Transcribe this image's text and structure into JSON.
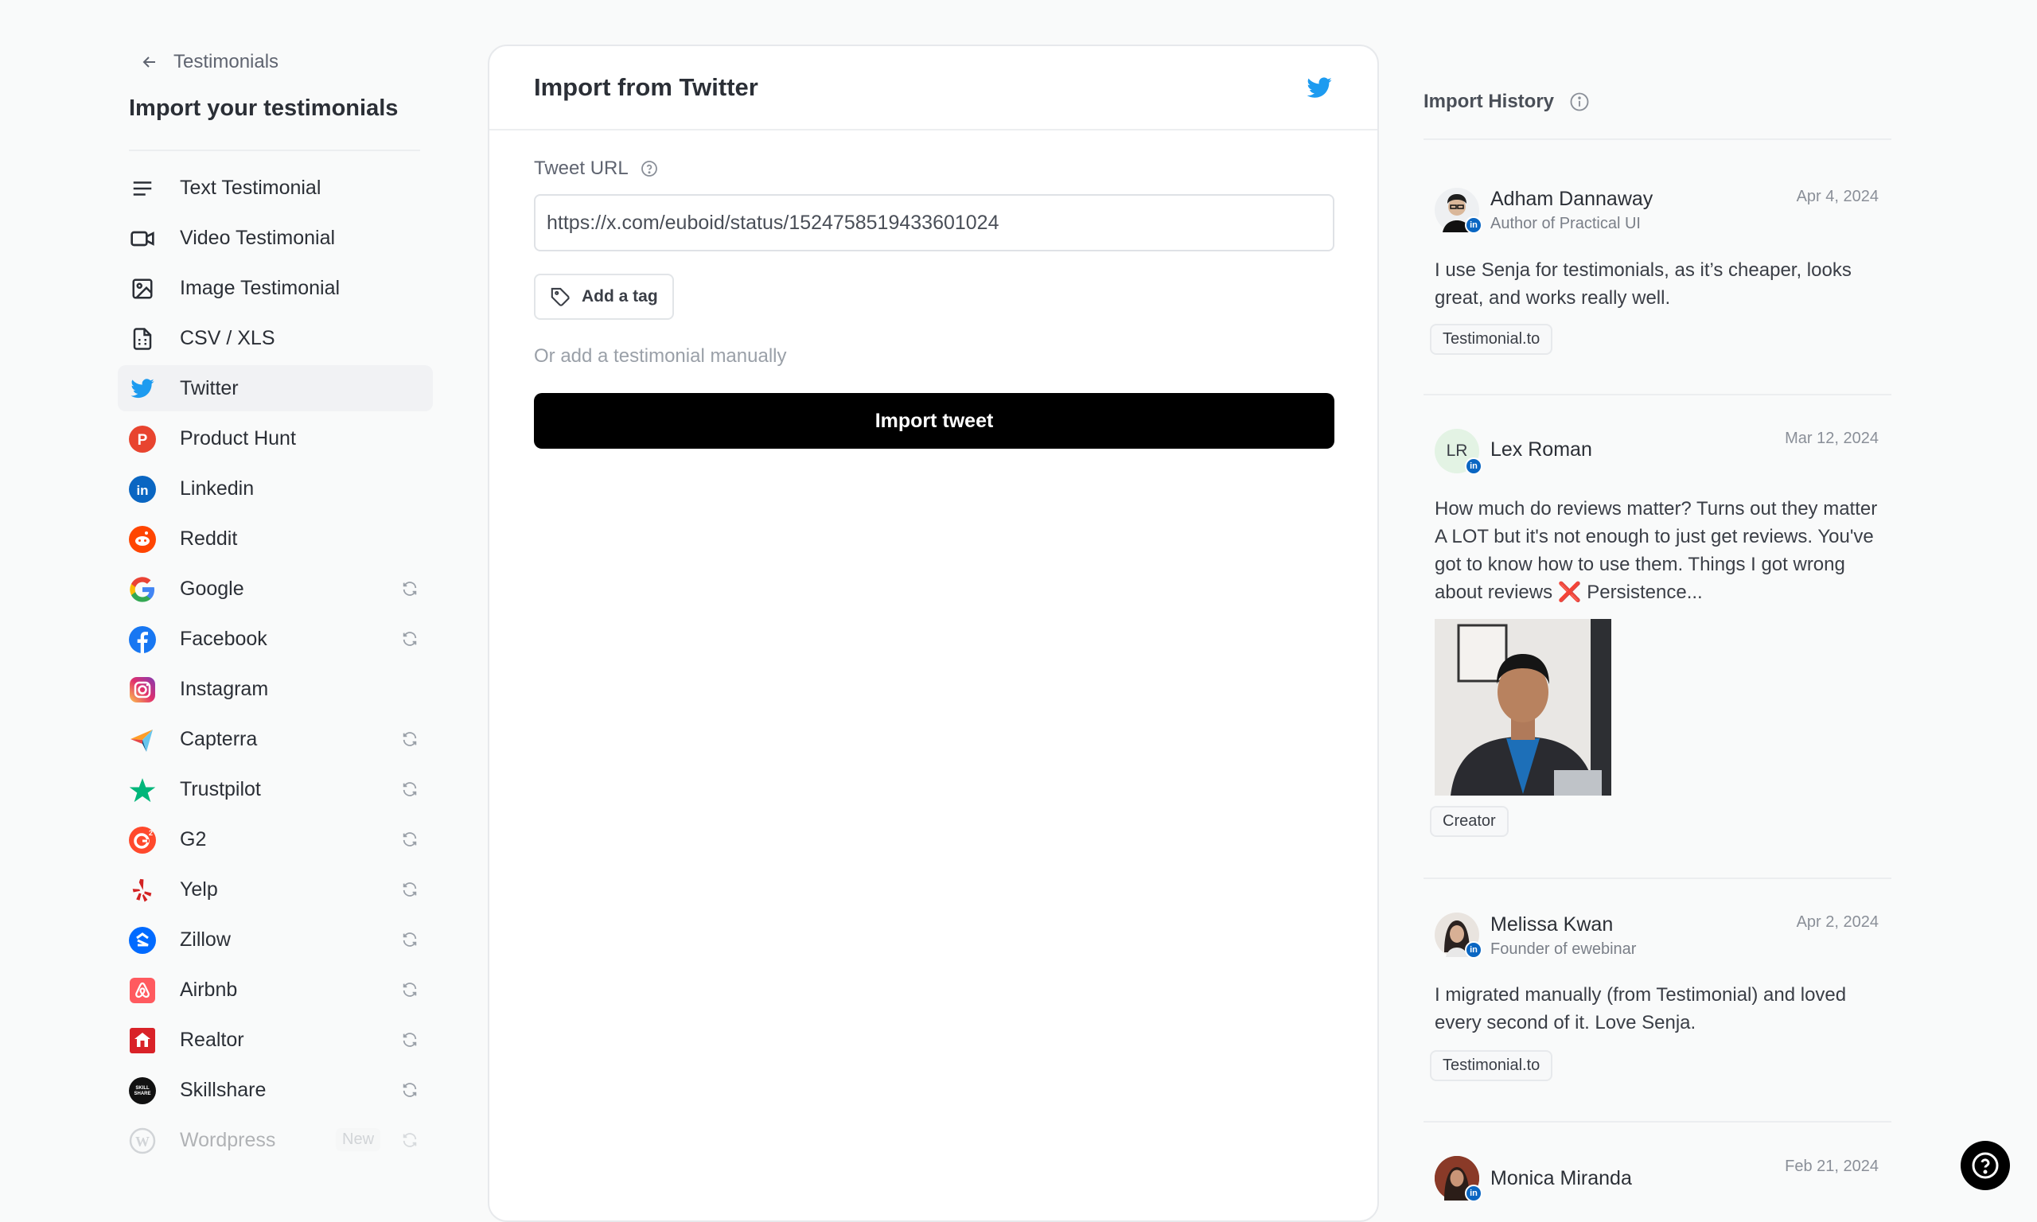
{
  "sidebar": {
    "back_label": "Testimonials",
    "title": "Import your testimonials",
    "items": [
      {
        "label": "Text Testimonial",
        "icon": "text-lines-icon",
        "sync": false
      },
      {
        "label": "Video Testimonial",
        "icon": "video-camera-icon",
        "sync": false
      },
      {
        "label": "Image Testimonial",
        "icon": "image-icon",
        "sync": false
      },
      {
        "label": "CSV / XLS",
        "icon": "spreadsheet-file-icon",
        "sync": false
      },
      {
        "label": "Twitter",
        "icon": "twitter-icon",
        "sync": false,
        "active": true
      },
      {
        "label": "Product Hunt",
        "icon": "product-hunt-icon",
        "sync": false
      },
      {
        "label": "Linkedin",
        "icon": "linkedin-icon",
        "sync": false
      },
      {
        "label": "Reddit",
        "icon": "reddit-icon",
        "sync": false
      },
      {
        "label": "Google",
        "icon": "google-icon",
        "sync": true
      },
      {
        "label": "Facebook",
        "icon": "facebook-icon",
        "sync": true
      },
      {
        "label": "Instagram",
        "icon": "instagram-icon",
        "sync": false
      },
      {
        "label": "Capterra",
        "icon": "capterra-icon",
        "sync": true
      },
      {
        "label": "Trustpilot",
        "icon": "trustpilot-star-icon",
        "sync": true
      },
      {
        "label": "G2",
        "icon": "g2-icon",
        "sync": true
      },
      {
        "label": "Yelp",
        "icon": "yelp-icon",
        "sync": true
      },
      {
        "label": "Zillow",
        "icon": "zillow-icon",
        "sync": true
      },
      {
        "label": "Airbnb",
        "icon": "airbnb-icon",
        "sync": true
      },
      {
        "label": "Realtor",
        "icon": "realtor-icon",
        "sync": true
      },
      {
        "label": "Skillshare",
        "icon": "skillshare-icon",
        "sync": true
      },
      {
        "label": "Wordpress",
        "icon": "wordpress-icon",
        "sync": true,
        "badge": "New",
        "dim": true
      }
    ]
  },
  "main": {
    "title": "Import from Twitter",
    "url_label": "Tweet URL",
    "url_value": "https://x.com/euboid/status/1524758519433601024",
    "tag_button": "Add a tag",
    "manual_link": "Or add a testimonial manually",
    "import_button": "Import tweet"
  },
  "history": {
    "title": "Import History",
    "cards": [
      {
        "name": "Adham Dannaway",
        "role": "Author of Practical UI",
        "date": "Apr 4, 2024",
        "text": "I use Senja for testimonials, as it’s cheaper, looks great, and works really well.",
        "tag": "Testimonial.to",
        "initials": ""
      },
      {
        "name": "Lex Roman",
        "role": "",
        "date": "Mar 12, 2024",
        "text": "How much do reviews matter? Turns out they matter A LOT but it's not enough to just get reviews. You've got to know how to use them. Things I got wrong about reviews ❌ Persistence...",
        "tag": "Creator",
        "initials": "LR"
      },
      {
        "name": "Melissa Kwan",
        "role": "Founder of ewebinar",
        "date": "Apr 2, 2024",
        "text": "I migrated manually (from Testimonial) and loved every second of it. Love Senja.",
        "tag": "Testimonial.to",
        "initials": ""
      },
      {
        "name": "Monica Miranda",
        "role": "",
        "date": "Feb 21, 2024",
        "text": "",
        "tag": "",
        "initials": ""
      }
    ]
  },
  "colors": {
    "twitter": "#1d9bf0",
    "linkedin": "#0a66c2",
    "primary_button": "#000000"
  }
}
